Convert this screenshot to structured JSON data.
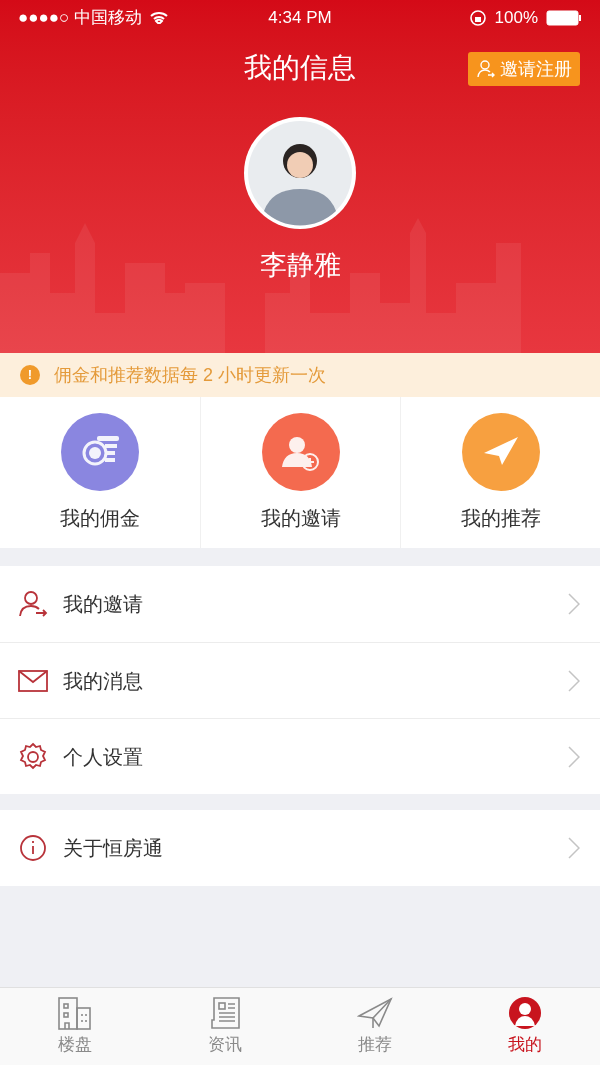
{
  "status_bar": {
    "carrier": "●●●●○ 中国移动",
    "time": "4:34 PM",
    "battery": "100%"
  },
  "header": {
    "title": "我的信息",
    "invite_button": "邀请注册",
    "user_name": "李静雅"
  },
  "notice": {
    "icon": "!",
    "text": "佣金和推荐数据每 2 小时更新一次"
  },
  "shortcuts": [
    {
      "label": "我的佣金",
      "color": "#8a86e0"
    },
    {
      "label": "我的邀请",
      "color": "#f46a4f"
    },
    {
      "label": "我的推荐",
      "color": "#f7a040"
    }
  ],
  "menu_groups": [
    [
      {
        "label": "我的邀请"
      },
      {
        "label": "我的消息"
      },
      {
        "label": "个人设置"
      }
    ],
    [
      {
        "label": "关于恒房通"
      }
    ]
  ],
  "tab_bar": [
    {
      "label": "楼盘",
      "selected": false
    },
    {
      "label": "资讯",
      "selected": false
    },
    {
      "label": "推荐",
      "selected": false
    },
    {
      "label": "我的",
      "selected": true
    }
  ]
}
